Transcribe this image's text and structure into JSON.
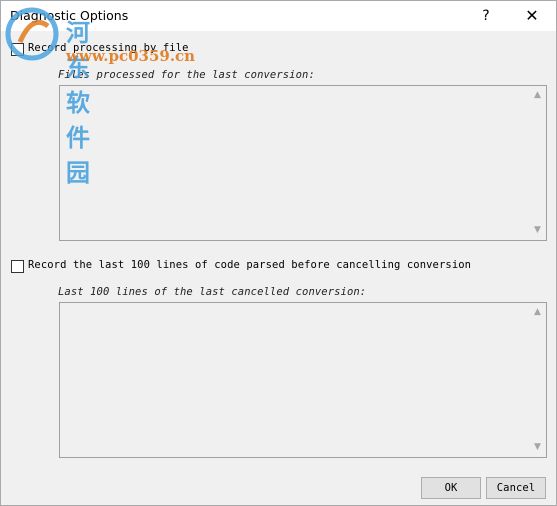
{
  "window": {
    "title": "Diagnostic Options",
    "help_glyph": "?",
    "close_glyph": "✕"
  },
  "options": {
    "record_by_file": {
      "label": "Record processing by file",
      "checked": false
    },
    "files_group_label": "Files processed for the last conversion:",
    "record_last_lines": {
      "label": "Record the last 100 lines of code parsed before cancelling conversion",
      "checked": false
    },
    "lines_group_label": "Last 100 lines of the last cancelled conversion:"
  },
  "scroll_arrows": {
    "up": "▲",
    "down": "▼"
  },
  "buttons": {
    "ok": "OK",
    "cancel": "Cancel"
  },
  "watermark": {
    "site_name": "河东软件园",
    "url": "www.pc0359.cn"
  },
  "colors": {
    "window_bg": "#f0f0f0",
    "watermark_blue": "#4aa3df",
    "watermark_orange": "#e07a1f"
  }
}
